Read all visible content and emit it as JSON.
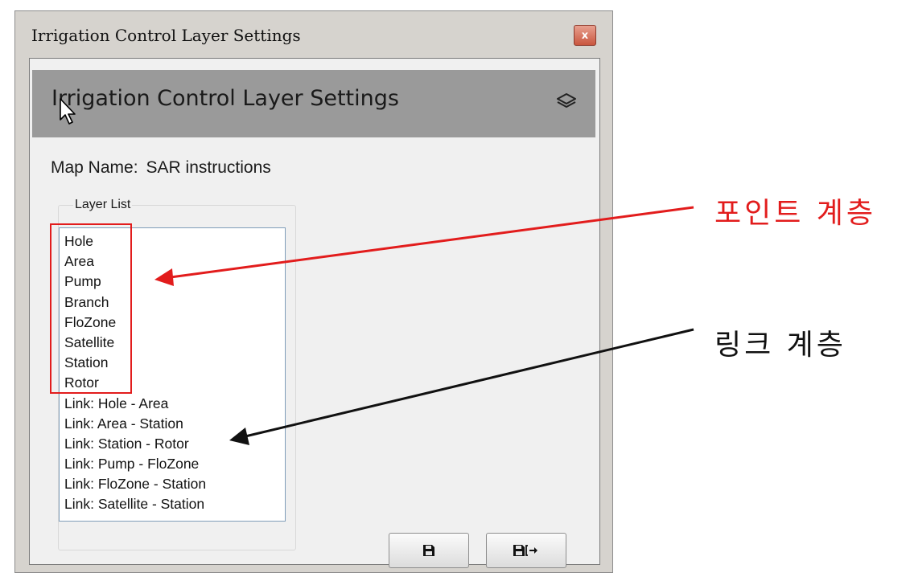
{
  "window": {
    "title": "Irrigation Control Layer Settings",
    "close_symbol": "x"
  },
  "header": {
    "title": "Irrigation Control Layer Settings",
    "icon": "layers-icon"
  },
  "map": {
    "label": "Map Name:",
    "value": "SAR instructions"
  },
  "layer_list": {
    "legend": "Layer List",
    "items": [
      "Hole",
      "Area",
      "Pump",
      "Branch",
      "FloZone",
      "Satellite",
      "Station",
      "Rotor",
      "Link: Hole - Area",
      "Link: Area - Station",
      "Link: Station - Rotor",
      "Link: Pump - FloZone",
      "Link: FloZone - Station",
      "Link: Satellite - Station"
    ]
  },
  "buttons": {
    "save_icon": "save-icon",
    "save_exit_icon": "save-exit-icon"
  },
  "annotations": {
    "point_layers": "포인트 계층",
    "link_layers": "링크 계층",
    "point_color": "#e21c1c",
    "link_color": "#111111"
  },
  "colors": {
    "header_bg": "#9a9a9a",
    "panel_bg": "#f0f0f0",
    "window_bg": "#d6d3ce"
  }
}
